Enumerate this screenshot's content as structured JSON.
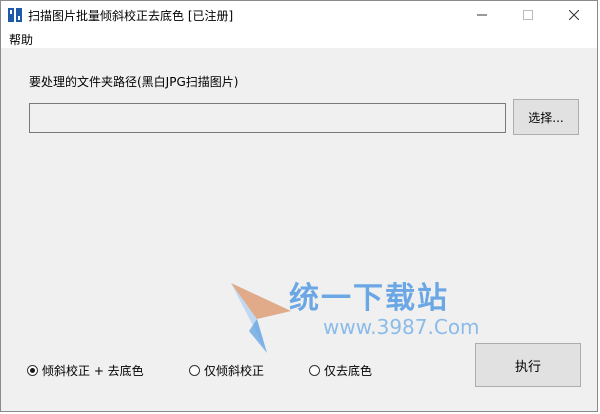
{
  "window": {
    "title": "扫描图片批量倾斜校正去底色 [已注册]",
    "minimize_icon": "minimize-icon",
    "maximize_icon": "maximize-icon",
    "close_icon": "close-icon"
  },
  "menu": {
    "items": [
      {
        "label": "帮助"
      }
    ]
  },
  "main": {
    "path_label": "要处理的文件夹路径(黑白JPG扫描图片)",
    "path_value": "",
    "select_button": "选择..."
  },
  "options": [
    {
      "label": "倾斜校正 + 去底色",
      "checked": true
    },
    {
      "label": "仅倾斜校正",
      "checked": false
    },
    {
      "label": "仅去底色",
      "checked": false
    }
  ],
  "run_button": "执行",
  "watermark": {
    "title": "统一下载站",
    "url": "www.3987.Com"
  },
  "colors": {
    "accent": "#1a5fb4",
    "watermark": "#6aa7e4"
  }
}
